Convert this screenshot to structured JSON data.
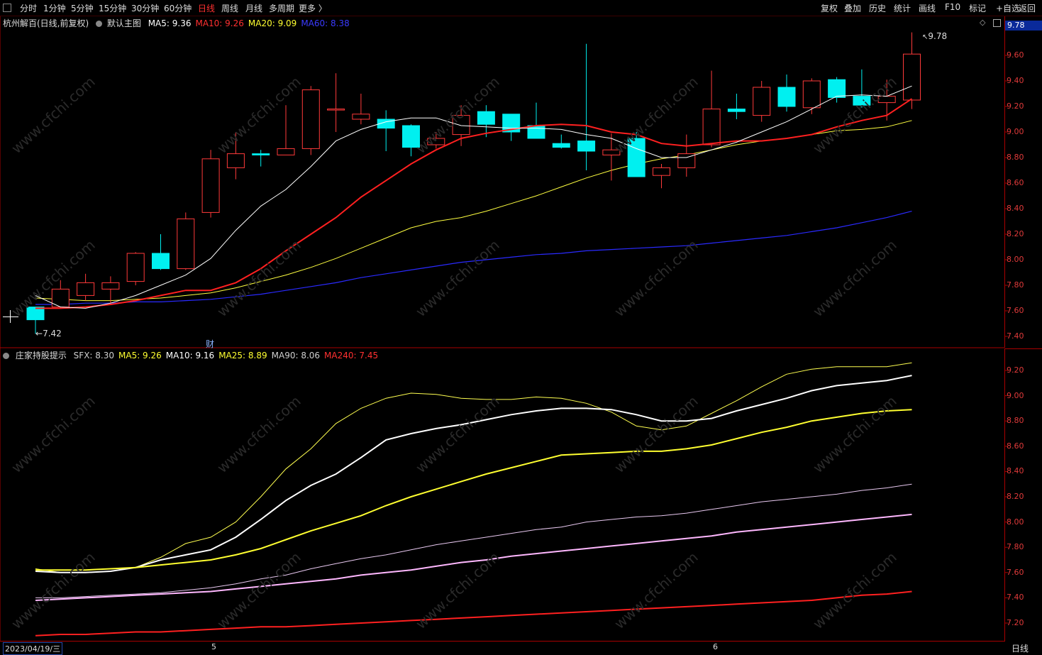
{
  "toolbar": {
    "left_items": [
      "分时",
      "1分钟",
      "5分钟",
      "15分钟",
      "30分钟",
      "60分钟",
      "日线",
      "周线",
      "月线",
      "多周期",
      "更多 〉"
    ],
    "active": "日线",
    "right_items": [
      "复权",
      "叠加",
      "历史",
      "统计",
      "画线",
      "F10",
      "标记",
      "+自选",
      "返回"
    ]
  },
  "main_header": {
    "stock": "杭州解百(日线,前复权)",
    "template": "默认主图",
    "ma": [
      {
        "label": "MA5:",
        "value": "9.36",
        "color": "#ffffff"
      },
      {
        "label": "MA10:",
        "value": "9.26",
        "color": "#ff3030"
      },
      {
        "label": "MA20:",
        "value": "9.09",
        "color": "#ffff30"
      },
      {
        "label": "MA60:",
        "value": "8.38",
        "color": "#3a3aff"
      }
    ],
    "price_flag": "9.78"
  },
  "sub_header": {
    "name": "庄家持股提示",
    "items": [
      {
        "label": "SFX:",
        "value": "8.30",
        "color": "#cfcfcf"
      },
      {
        "label": "MA5:",
        "value": "9.26",
        "color": "#ffff30"
      },
      {
        "label": "MA10:",
        "value": "9.16",
        "color": "#ffffff"
      },
      {
        "label": "MA25:",
        "value": "8.89",
        "color": "#ffff30"
      },
      {
        "label": "MA90:",
        "value": "8.06",
        "color": "#cfcfcf"
      },
      {
        "label": "MA240:",
        "value": "7.45",
        "color": "#ff3030"
      }
    ]
  },
  "annotations": {
    "high": "9.78",
    "low": "7.42",
    "marker": "财"
  },
  "date_bar": {
    "first": "2023/04/19/三",
    "m5": "5",
    "m6": "6",
    "period": "日线"
  },
  "watermark": "www.cfchi.com",
  "colors": {
    "up": "#ff3a3a",
    "down": "#00f0f0",
    "axis": "#aa0000",
    "ma5": "#ffffff",
    "ma10": "#ff2020",
    "ma20": "#ffff40",
    "ma60": "#2a2aff"
  },
  "chart_data": [
    {
      "type": "candlestick",
      "y_ticks": [
        "9.60",
        "9.40",
        "9.20",
        "9.00",
        "8.80",
        "8.60",
        "8.40",
        "8.20",
        "8.00",
        "7.80",
        "7.60",
        "7.40"
      ],
      "ylim": [
        7.34,
        9.84
      ],
      "candles": [
        [
          7.63,
          7.53,
          7.63,
          7.42
        ],
        [
          7.63,
          7.77,
          7.84,
          7.62
        ],
        [
          7.72,
          7.82,
          7.89,
          7.68
        ],
        [
          7.77,
          7.82,
          7.87,
          7.66
        ],
        [
          7.83,
          8.05,
          8.06,
          7.8
        ],
        [
          8.05,
          7.93,
          8.2,
          7.92
        ],
        [
          7.93,
          8.32,
          8.37,
          7.92
        ],
        [
          8.37,
          8.79,
          8.86,
          8.33
        ],
        [
          8.72,
          8.83,
          9.0,
          8.63
        ],
        [
          8.83,
          8.82,
          8.86,
          8.73
        ],
        [
          8.82,
          8.87,
          9.21,
          8.82
        ],
        [
          8.87,
          9.33,
          9.36,
          8.82
        ],
        [
          9.18,
          9.18,
          9.46,
          9.0
        ],
        [
          9.1,
          9.14,
          9.3,
          9.06
        ],
        [
          9.1,
          9.03,
          9.17,
          8.85
        ],
        [
          9.05,
          8.88,
          9.06,
          8.81
        ],
        [
          8.9,
          8.95,
          9.0,
          8.87
        ],
        [
          8.98,
          9.13,
          9.21,
          8.89
        ],
        [
          9.16,
          9.06,
          9.21,
          8.96
        ],
        [
          9.14,
          9.0,
          9.11,
          8.93
        ],
        [
          9.05,
          8.95,
          9.23,
          8.98
        ],
        [
          8.91,
          8.88,
          8.98,
          8.87
        ],
        [
          8.93,
          8.85,
          9.69,
          8.7
        ],
        [
          8.82,
          8.86,
          8.99,
          8.62
        ],
        [
          8.95,
          8.65,
          9.0,
          8.65
        ],
        [
          8.66,
          8.72,
          8.75,
          8.56
        ],
        [
          8.72,
          8.83,
          8.98,
          8.65
        ],
        [
          8.9,
          9.18,
          9.48,
          8.88
        ],
        [
          9.18,
          9.16,
          9.3,
          9.1
        ],
        [
          9.13,
          9.35,
          9.4,
          9.08
        ],
        [
          9.35,
          9.2,
          9.45,
          9.16
        ],
        [
          9.19,
          9.4,
          9.42,
          9.14
        ],
        [
          9.41,
          9.27,
          9.43,
          9.23
        ],
        [
          9.28,
          9.21,
          9.49,
          9.19
        ],
        [
          9.23,
          9.28,
          9.41,
          9.09
        ],
        [
          9.25,
          9.61,
          9.78,
          9.18
        ]
      ],
      "ma5": [
        7.72,
        7.63,
        7.62,
        7.66,
        7.72,
        7.8,
        7.88,
        8.01,
        8.23,
        8.42,
        8.55,
        8.73,
        8.93,
        9.02,
        9.08,
        9.11,
        9.11,
        9.05,
        9.04,
        9.03,
        9.03,
        9.02,
        8.98,
        8.95,
        8.87,
        8.8,
        8.8,
        8.86,
        8.92,
        9.0,
        9.08,
        9.18,
        9.28,
        9.29,
        9.28,
        9.36
      ],
      "ma10": [
        7.62,
        7.62,
        7.63,
        7.65,
        7.68,
        7.72,
        7.76,
        7.76,
        7.82,
        7.93,
        8.07,
        8.2,
        8.33,
        8.49,
        8.62,
        8.75,
        8.86,
        8.95,
        8.99,
        9.02,
        9.05,
        9.06,
        9.05,
        9.0,
        8.98,
        8.91,
        8.89,
        8.91,
        8.93,
        8.93,
        8.95,
        8.98,
        9.04,
        9.09,
        9.13,
        9.26
      ],
      "ma20": [
        7.7,
        7.69,
        7.68,
        7.68,
        7.69,
        7.7,
        7.72,
        7.74,
        7.78,
        7.83,
        7.88,
        7.94,
        8.01,
        8.09,
        8.17,
        8.25,
        8.3,
        8.33,
        8.38,
        8.44,
        8.5,
        8.57,
        8.64,
        8.7,
        8.75,
        8.79,
        8.82,
        8.86,
        8.9,
        8.93,
        8.95,
        8.98,
        9.01,
        9.02,
        9.04,
        9.09
      ],
      "ma60": [
        7.65,
        7.65,
        7.66,
        7.66,
        7.67,
        7.67,
        7.68,
        7.69,
        7.71,
        7.73,
        7.76,
        7.79,
        7.82,
        7.86,
        7.89,
        7.92,
        7.95,
        7.98,
        8.0,
        8.02,
        8.04,
        8.05,
        8.07,
        8.08,
        8.09,
        8.1,
        8.11,
        8.13,
        8.15,
        8.17,
        8.19,
        8.22,
        8.25,
        8.29,
        8.33,
        8.38
      ]
    },
    {
      "type": "line",
      "title": "庄家持股提示",
      "y_ticks": [
        "9.20",
        "9.00",
        "8.80",
        "8.60",
        "8.40",
        "8.20",
        "8.00",
        "7.80",
        "7.60",
        "7.40",
        "7.20"
      ],
      "ylim": [
        7.12,
        9.32
      ],
      "series": [
        {
          "name": "MA5",
          "values": [
            7.63,
            7.6,
            7.6,
            7.61,
            7.64,
            7.72,
            7.83,
            7.88,
            8.0,
            8.2,
            8.42,
            8.58,
            8.78,
            8.9,
            8.98,
            9.02,
            9.01,
            8.98,
            8.97,
            8.97,
            8.99,
            8.98,
            8.94,
            8.87,
            8.76,
            8.73,
            8.76,
            8.86,
            8.96,
            9.07,
            9.17,
            9.21,
            9.23,
            9.23,
            9.23,
            9.26
          ]
        },
        {
          "name": "MA10",
          "values": [
            7.61,
            7.6,
            7.6,
            7.61,
            7.64,
            7.7,
            7.74,
            7.78,
            7.88,
            8.02,
            8.17,
            8.29,
            8.38,
            8.51,
            8.65,
            8.7,
            8.74,
            8.77,
            8.81,
            8.85,
            8.88,
            8.9,
            8.9,
            8.89,
            8.85,
            8.8,
            8.8,
            8.82,
            8.88,
            8.93,
            8.98,
            9.04,
            9.08,
            9.1,
            9.12,
            9.16
          ]
        },
        {
          "name": "MA25",
          "values": [
            7.62,
            7.62,
            7.62,
            7.63,
            7.64,
            7.66,
            7.68,
            7.7,
            7.74,
            7.79,
            7.86,
            7.93,
            7.99,
            8.05,
            8.13,
            8.2,
            8.26,
            8.32,
            8.38,
            8.43,
            8.48,
            8.53,
            8.54,
            8.55,
            8.56,
            8.56,
            8.58,
            8.61,
            8.66,
            8.71,
            8.75,
            8.8,
            8.83,
            8.86,
            8.88,
            8.89
          ]
        },
        {
          "name": "SFX",
          "values": [
            7.4,
            7.4,
            7.41,
            7.42,
            7.43,
            7.44,
            7.46,
            7.48,
            7.51,
            7.55,
            7.58,
            7.63,
            7.67,
            7.71,
            7.74,
            7.78,
            7.82,
            7.85,
            7.88,
            7.91,
            7.94,
            7.96,
            8.0,
            8.02,
            8.04,
            8.05,
            8.07,
            8.1,
            8.13,
            8.16,
            8.18,
            8.2,
            8.22,
            8.25,
            8.27,
            8.3
          ]
        },
        {
          "name": "MA90",
          "values": [
            7.38,
            7.39,
            7.4,
            7.41,
            7.42,
            7.43,
            7.44,
            7.45,
            7.47,
            7.49,
            7.51,
            7.53,
            7.55,
            7.58,
            7.6,
            7.62,
            7.65,
            7.68,
            7.7,
            7.73,
            7.75,
            7.77,
            7.79,
            7.81,
            7.83,
            7.85,
            7.87,
            7.89,
            7.92,
            7.94,
            7.96,
            7.98,
            8.0,
            8.02,
            8.04,
            8.06
          ]
        },
        {
          "name": "MA240",
          "values": [
            7.1,
            7.11,
            7.11,
            7.12,
            7.13,
            7.13,
            7.14,
            7.15,
            7.16,
            7.17,
            7.17,
            7.18,
            7.19,
            7.2,
            7.21,
            7.22,
            7.23,
            7.24,
            7.25,
            7.26,
            7.27,
            7.28,
            7.29,
            7.3,
            7.31,
            7.32,
            7.33,
            7.34,
            7.35,
            7.36,
            7.37,
            7.38,
            7.4,
            7.42,
            7.43,
            7.45
          ]
        }
      ]
    }
  ]
}
